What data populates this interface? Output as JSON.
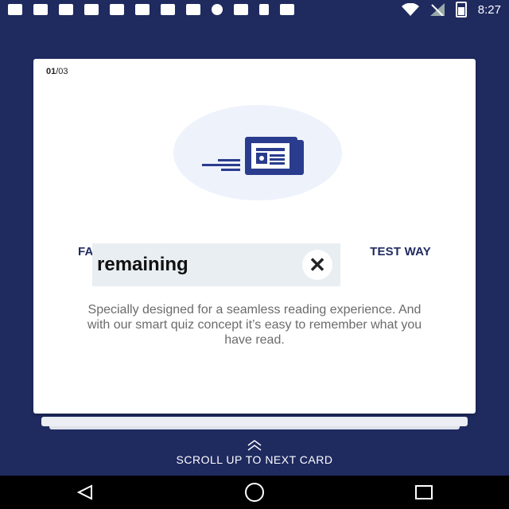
{
  "status_bar": {
    "time": "8:27",
    "left_icons": [
      "message-icon",
      "facebook-icon",
      "facebook-icon",
      "facebook-icon",
      "facebook-icon",
      "facebook-icon",
      "wrench-icon",
      "facebook-icon",
      "info-icon",
      "satellite-icon",
      "lock-icon",
      "photo-icon"
    ],
    "right_icons": [
      "wifi-icon",
      "no-signal-icon",
      "battery-icon"
    ]
  },
  "card": {
    "page_current": "01",
    "page_total": "/03",
    "title_left": "FA",
    "title_right": "TEST WAY",
    "description": "Specially designed for a seamless reading experience. And with our smart quiz concept it’s easy to remember what you have read."
  },
  "ad_overlay": {
    "text": "remaining",
    "close_icon": "close-icon"
  },
  "footer": {
    "scroll_label": "SCROLL UP TO NEXT CARD"
  },
  "nav_bar": {
    "back_icon": "back-triangle-icon",
    "home_icon": "home-circle-icon",
    "recents_icon": "recents-square-icon"
  },
  "colors": {
    "background": "#1f2a5f",
    "accent": "#2a3c8e",
    "card": "#ffffff"
  }
}
